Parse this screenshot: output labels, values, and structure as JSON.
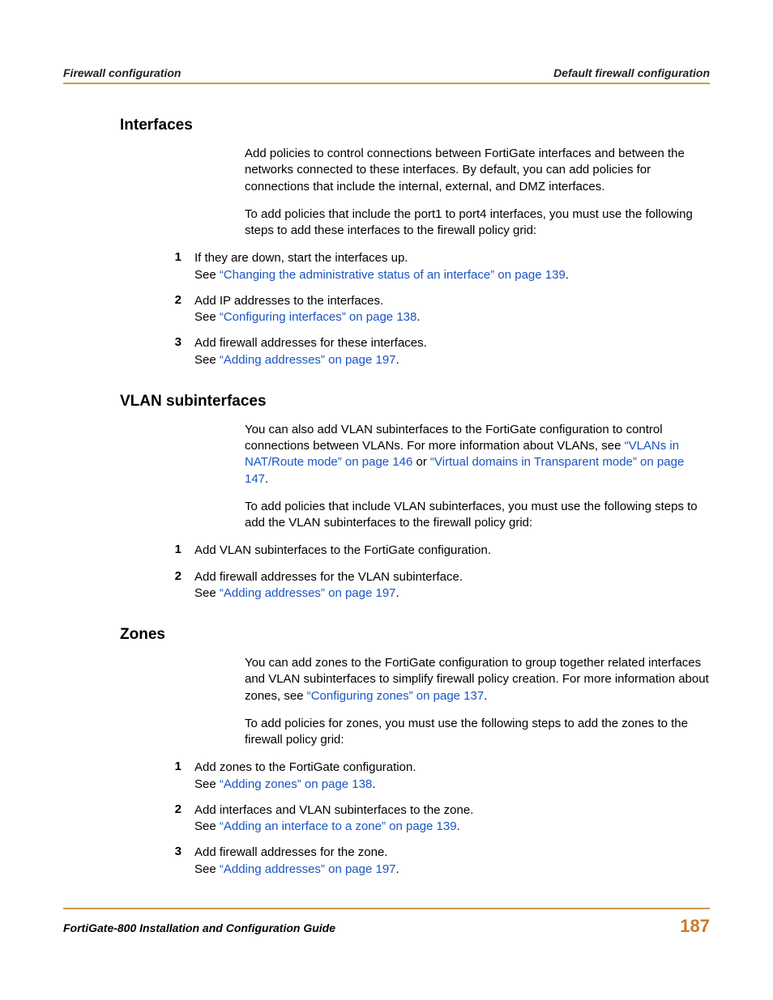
{
  "header": {
    "left": "Firewall configuration",
    "right": "Default firewall configuration"
  },
  "sections": {
    "interfaces": {
      "heading": "Interfaces",
      "para1": "Add policies to control connections between FortiGate interfaces and between the networks connected to these interfaces. By default, you can add policies for connections that include the internal, external, and DMZ interfaces.",
      "para2": "To add policies that include the port1 to port4 interfaces, you must use the following steps to add these interfaces to the firewall policy grid:",
      "items": [
        {
          "num": "1",
          "line1": "If they are down, start the interfaces up.",
          "line2_prefix": "See ",
          "link": "“Changing the administrative status of an interface” on page 139",
          "line2_suffix": "."
        },
        {
          "num": "2",
          "line1": "Add IP addresses to the interfaces.",
          "line2_prefix": "See ",
          "link": "“Configuring interfaces” on page 138",
          "line2_suffix": "."
        },
        {
          "num": "3",
          "line1": "Add firewall addresses for these interfaces.",
          "line2_prefix": "See ",
          "link": "“Adding addresses” on page 197",
          "line2_suffix": "."
        }
      ]
    },
    "vlan": {
      "heading": "VLAN subinterfaces",
      "para1_prefix": "You can also add VLAN subinterfaces to the FortiGate configuration to control connections between VLANs. For more information about VLANs, see ",
      "link1": "“VLANs in NAT/Route mode” on page 146",
      "mid": " or ",
      "link2": "“Virtual domains in Transparent mode” on page 147",
      "para1_suffix": ".",
      "para2": "To add policies that include VLAN subinterfaces, you must use the following steps to add the VLAN subinterfaces to the firewall policy grid:",
      "items": [
        {
          "num": "1",
          "line1": "Add VLAN subinterfaces to the FortiGate configuration.",
          "has_link": false
        },
        {
          "num": "2",
          "line1": "Add firewall addresses for the VLAN subinterface.",
          "line2_prefix": "See ",
          "link": "“Adding addresses” on page 197",
          "line2_suffix": ".",
          "has_link": true
        }
      ]
    },
    "zones": {
      "heading": "Zones",
      "para1_prefix": "You can add zones to the FortiGate configuration to group together related interfaces and VLAN subinterfaces to simplify firewall policy creation. For more information about zones, see ",
      "link1": "“Configuring zones” on page 137",
      "para1_suffix": ".",
      "para2": "To add policies for zones, you must use the following steps to add the zones to the firewall policy grid:",
      "items": [
        {
          "num": "1",
          "line1": "Add zones to the FortiGate configuration.",
          "line2_prefix": "See ",
          "link": "“Adding zones” on page 138",
          "line2_suffix": "."
        },
        {
          "num": "2",
          "line1": "Add interfaces and VLAN subinterfaces to the zone.",
          "line2_prefix": "See ",
          "link": "“Adding an interface to a zone” on page 139",
          "line2_suffix": "."
        },
        {
          "num": "3",
          "line1": "Add firewall addresses for the zone.",
          "line2_prefix": "See ",
          "link": "“Adding addresses” on page 197",
          "line2_suffix": "."
        }
      ]
    }
  },
  "footer": {
    "left": "FortiGate-800 Installation and Configuration Guide",
    "right": "187"
  }
}
